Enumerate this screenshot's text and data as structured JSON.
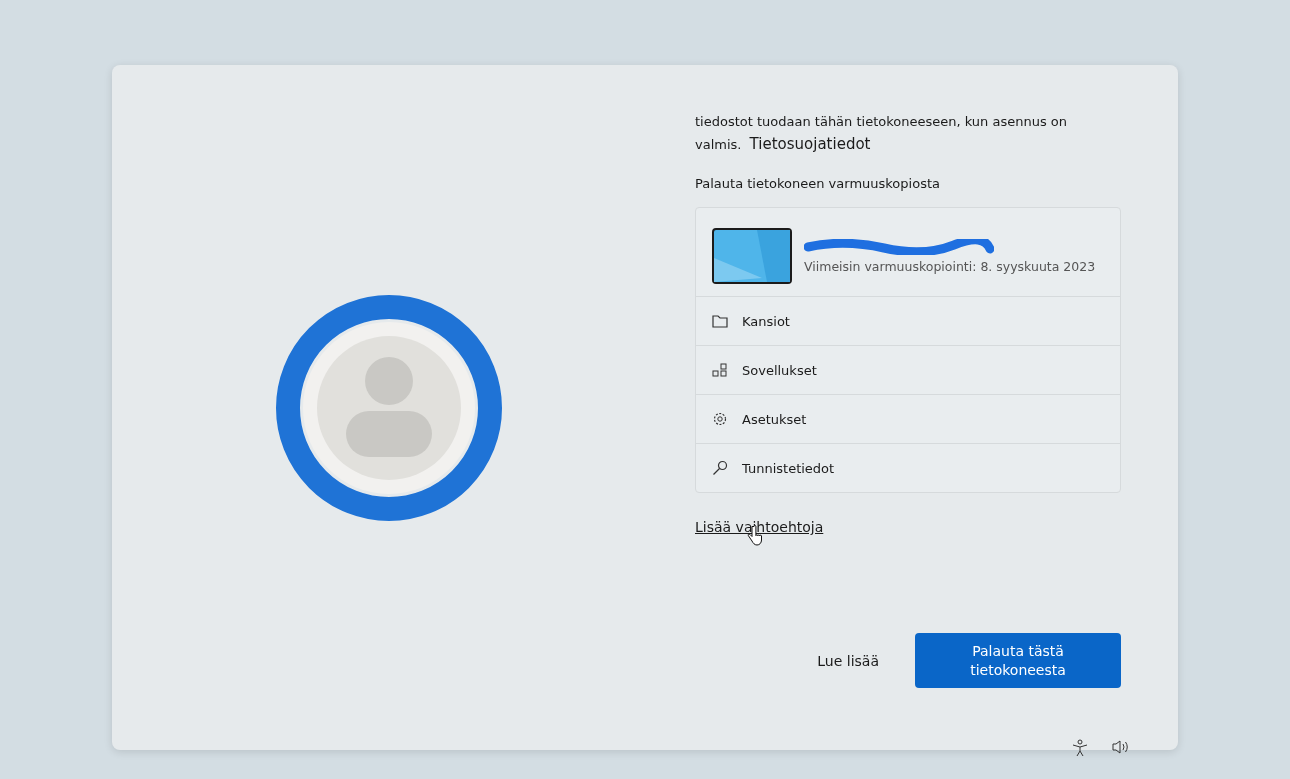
{
  "intro": {
    "text": "tiedostot tuodaan tähän tietokoneeseen, kun asennus on valmis.",
    "link": "Tietosuojatiedot"
  },
  "section_heading": "Palauta tietokoneen varmuuskopiosta",
  "backup": {
    "name_redacted": true,
    "last_backup": "Viimeisin varmuuskopiointi: 8. syyskuuta 2023",
    "items": [
      {
        "kind": "folder",
        "label": "Kansiot"
      },
      {
        "kind": "apps",
        "label": "Sovellukset"
      },
      {
        "kind": "settings",
        "label": "Asetukset"
      },
      {
        "kind": "key",
        "label": "Tunnistetiedot"
      }
    ]
  },
  "more_options": "Lisää vaihtoehtoja",
  "buttons": {
    "secondary": "Lue lisää",
    "primary": "Palauta tästä tietokoneesta"
  }
}
